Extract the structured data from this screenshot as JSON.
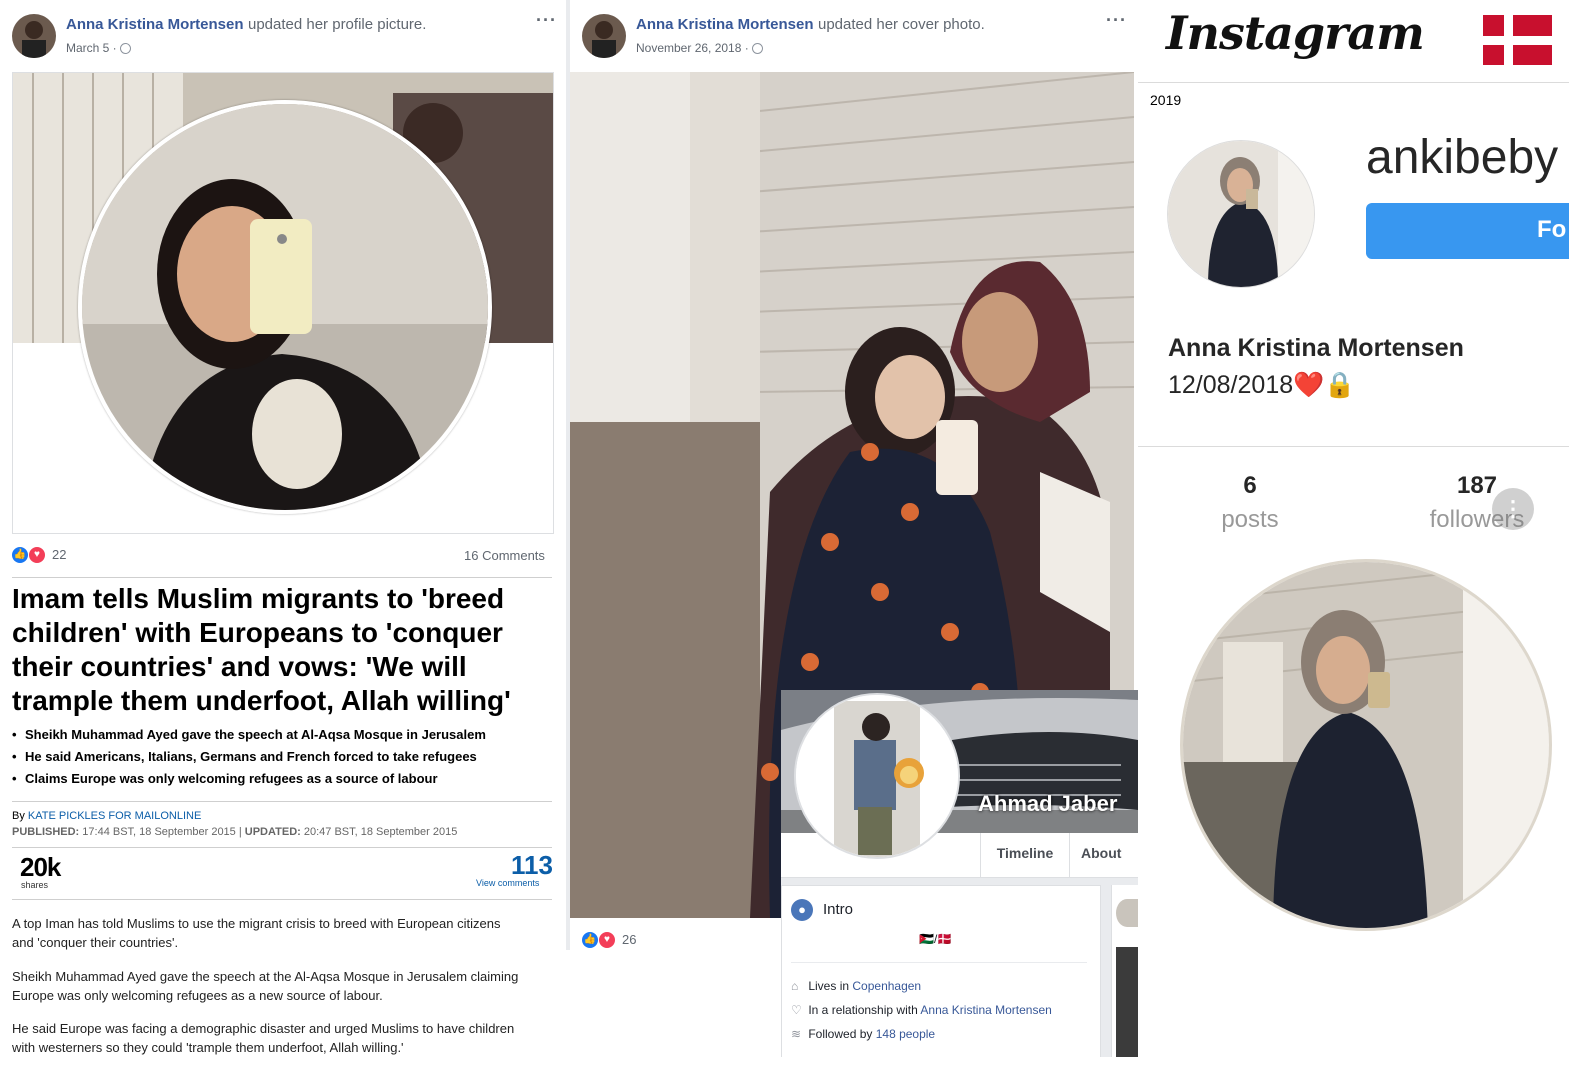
{
  "post1": {
    "author": "Anna Kristina Mortensen",
    "action": "updated her profile picture.",
    "date": "March 5 ·",
    "reaction_count": "22",
    "comments": "16 Comments"
  },
  "article": {
    "headline": "Imam tells Muslim migrants to 'breed children' with Europeans to 'conquer their countries' and vows: 'We will trample them underfoot, Allah willing'",
    "bullets": [
      "Sheikh Muhammad Ayed gave the speech at Al-Aqsa Mosque in Jerusalem",
      "He said Americans, Italians, Germans and French forced to take refugees",
      "Claims Europe was only welcoming refugees as a source of labour"
    ],
    "by_prefix": "By",
    "author": "KATE PICKLES FOR MAILONLINE",
    "published_label": "PUBLISHED:",
    "published_value": "17:44 BST, 18 September 2015",
    "separator": "|",
    "updated_label": "UPDATED:",
    "updated_value": "20:47 BST, 18 September 2015",
    "shares_num": "20k",
    "shares_label": "shares",
    "comments_num": "113",
    "comments_label": "View comments",
    "paragraphs": [
      "A top Iman has told Muslims to use the migrant crisis to breed with European citizens and 'conquer their countries'.",
      "Sheikh Muhammad Ayed gave the speech at the Al-Aqsa Mosque in Jerusalem claiming Europe was only welcoming refugees as a new source of labour.",
      "He said Europe was facing a demographic disaster and urged Muslims to have children with westerners so they could 'trample them underfoot, Allah willing.'"
    ]
  },
  "post2": {
    "author": "Anna Kristina Mortensen",
    "action": "updated her cover photo.",
    "date": "November 26, 2018 ·",
    "reaction_count": "26"
  },
  "ahmad": {
    "name": "Ahmad Jaber",
    "tab_timeline": "Timeline",
    "tab_about": "About",
    "intro_title": "Intro",
    "flags": "🇯🇴/🇩🇰",
    "lives_prefix": "Lives in",
    "lives_city": "Copenhagen",
    "relationship_prefix": "In a relationship with",
    "relationship_name": "Anna Kristina Mortensen",
    "followed_prefix": "Followed by",
    "followed_count": "148 people"
  },
  "instagram": {
    "logo": "Instagram",
    "year": "2019",
    "username": "ankibeby",
    "follow_label": "Fo",
    "full_name": "Anna Kristina Mortensen",
    "bio": "12/08/2018❤️🔒",
    "posts_num": "6",
    "posts_label": "posts",
    "followers_num": "187",
    "followers_label": "followers",
    "more_icon": "⋮",
    "colors": {
      "follow_blue": "#3897f0",
      "flag_red": "#c8102e"
    }
  }
}
